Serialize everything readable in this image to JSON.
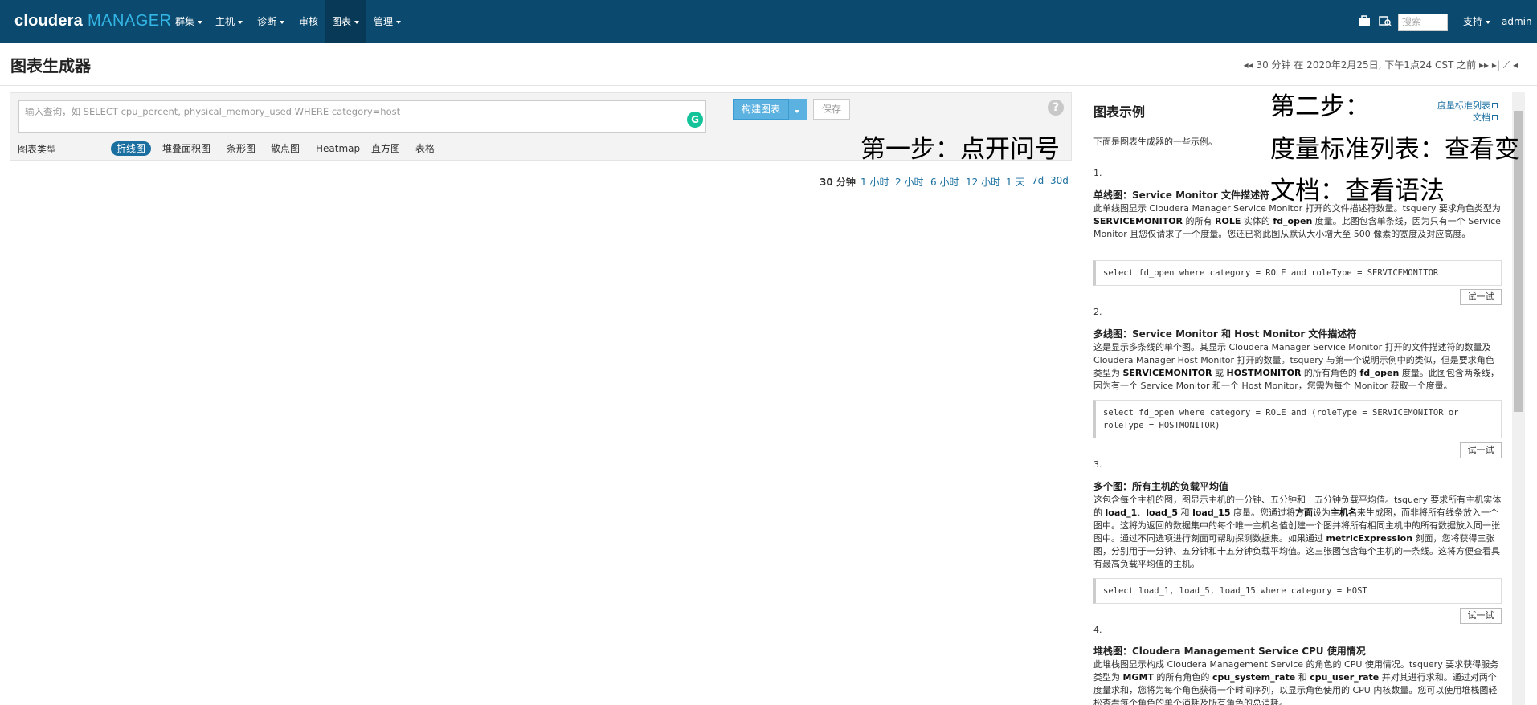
{
  "brand": {
    "cloudera": "cloudera",
    "manager": "MANAGER"
  },
  "nav": {
    "items": [
      {
        "label": "群集",
        "dropdown": true
      },
      {
        "label": "主机",
        "dropdown": true
      },
      {
        "label": "诊断",
        "dropdown": true
      },
      {
        "label": "审核",
        "dropdown": false
      },
      {
        "label": "图表",
        "dropdown": true,
        "active": true
      },
      {
        "label": "管理",
        "dropdown": true
      }
    ],
    "search_placeholder": "搜索",
    "support": "支持",
    "user": "admin"
  },
  "page": {
    "title": "图表生成器",
    "timebar": "30 分钟 在 2020年2月25日, 下午1点24 CST 之前"
  },
  "builder": {
    "query_placeholder": "输入查询，如 SELECT cpu_percent, physical_memory_used WHERE category=host",
    "build_label": "构建图表",
    "save_label": "保存",
    "help": "?",
    "grammarly": "G",
    "chart_type_label": "图表类型",
    "chart_types": [
      "折线图",
      "堆叠面积图",
      "条形图",
      "散点图",
      "Heatmap",
      "直方图",
      "表格"
    ],
    "active_chart_type": "折线图"
  },
  "time_ranges": {
    "current": "30 分钟",
    "options": [
      "1 小时",
      "2 小时",
      "6 小时",
      "12 小时",
      "1 天",
      "7d",
      "30d"
    ]
  },
  "annotations": {
    "step1": "第一步：点开问号",
    "step2_line1": "第二步：",
    "step2_line2": "度量标准列表：查看变",
    "step2_line3": "文档：查看语法"
  },
  "panel": {
    "title": "图表示例",
    "link_metrics": "度量标准列表",
    "link_docs": "文档",
    "intro": "下面是图表生成器的一些示例。",
    "try_label": "试一试",
    "examples": [
      {
        "num": "1.",
        "title": "单线图：Service Monitor 文件描述符",
        "desc_html": "此单线图显示 Cloudera Manager Service Monitor 打开的文件描述符数量。tsquery 要求角色类型为 <b>SERVICEMONITOR</b> 的所有 <b>ROLE</b> 实体的 <b>fd_open</b> 度量。此图包含单条线，因为只有一个 Service Monitor 且您仅请求了一个度量。您还已将此图从默认大小增大至 500 像素的宽度及对应高度。",
        "code": "select fd_open where category = ROLE and roleType = SERVICEMONITOR"
      },
      {
        "num": "2.",
        "title": "多线图：Service Monitor 和 Host Monitor 文件描述符",
        "desc_html": "这是显示多条线的单个图。其显示 Cloudera Manager Service Monitor 打开的文件描述符的数量及 Cloudera Manager Host Monitor 打开的数量。tsquery 与第一个说明示例中的类似，但是要求角色类型为 <b>SERVICEMONITOR</b> 或 <b>HOSTMONITOR</b> 的所有角色的 <b>fd_open</b> 度量。此图包含两条线，因为有一个 Service Monitor 和一个 Host Monitor，您需为每个 Monitor 获取一个度量。",
        "code": "select fd_open where category = ROLE and (roleType = SERVICEMONITOR or roleType = HOSTMONITOR)"
      },
      {
        "num": "3.",
        "title": "多个图：所有主机的负载平均值",
        "desc_html": "这包含每个主机的图，图显示主机的一分钟、五分钟和十五分钟负载平均值。tsquery 要求所有主机实体的 <b>load_1</b>、<b>load_5</b> 和 <b>load_15</b> 度量。您通过将<b>方面</b>设为<b>主机名</b>来生成图，而非将所有线条放入一个图中。这将为返回的数据集中的每个唯一主机名值创建一个图并将所有相同主机中的所有数据放入同一张图中。通过不同选项进行刻面可帮助探测数据集。如果通过 <b>metricExpression</b> 刻面，您将获得三张图，分别用于一分钟、五分钟和十五分钟负载平均值。这三张图包含每个主机的一条线。这将方便查看具有最高负载平均值的主机。",
        "code": "select load_1, load_5, load_15 where category = HOST"
      },
      {
        "num": "4.",
        "title": "堆栈图：Cloudera Management Service CPU 使用情况",
        "desc_html": "此堆栈图显示构成 Cloudera Management Service 的角色的 CPU 使用情况。tsquery 要求获得服务类型为 <b>MGMT</b> 的所有角色的 <b>cpu_system_rate</b> 和 <b>cpu_user_rate</b> 并对其进行求和。通过对两个度量求和，您将为每个角色获得一个时间序列，以显示角色使用的 CPU 内核数量。您可以使用堆栈图轻松查看每个角色的单个消耗及所有角色的总消耗。",
        "code": ""
      }
    ]
  }
}
